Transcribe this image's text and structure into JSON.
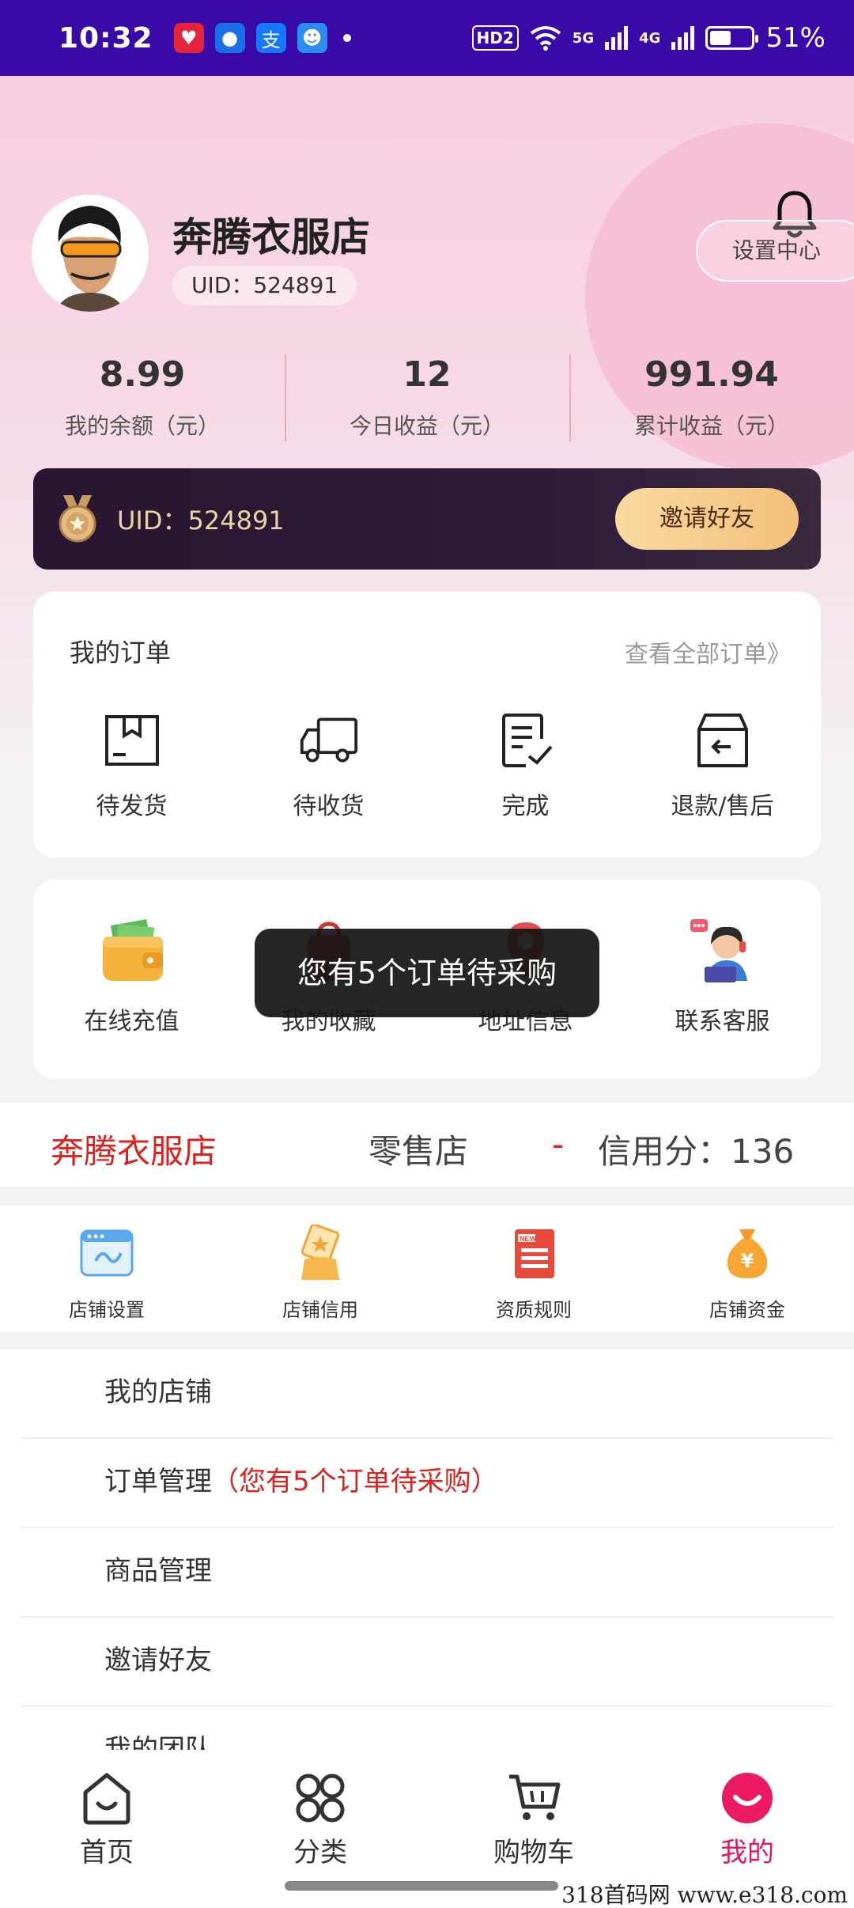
{
  "status_bar": {
    "time": "10:32",
    "hd": "HD2",
    "net1": "5G",
    "net2": "4G",
    "battery": "51%"
  },
  "profile": {
    "shop_name": "奔腾衣服店",
    "uid_pill": "UID：524891",
    "settings": "设置中心"
  },
  "stats": [
    {
      "value": "8.99",
      "label": "我的余额（元）"
    },
    {
      "value": "12",
      "label": "今日收益（元）"
    },
    {
      "value": "991.94",
      "label": "累计收益（元）"
    }
  ],
  "vip": {
    "uid": "UID：524891",
    "invite": "邀请好友"
  },
  "orders": {
    "title": "我的订单",
    "more": "查看全部订单》",
    "items": [
      "待发货",
      "待收货",
      "完成",
      "退款/售后"
    ]
  },
  "tools": {
    "items": [
      "在线充值",
      "我的收藏",
      "地址信息",
      "联系客服"
    ]
  },
  "toast": "您有5个订单待采购",
  "shop_row": {
    "name": "奔腾衣服店",
    "type": "零售店",
    "dash": "-",
    "credit": "信用分：136"
  },
  "shop_tools": [
    "店铺设置",
    "店铺信用",
    "资质规则",
    "店铺资金"
  ],
  "menu": {
    "my_shop": "我的店铺",
    "order_mgmt": "订单管理",
    "order_note": "（您有5个订单待采购）",
    "goods_mgmt": "商品管理",
    "invite": "邀请好友",
    "team": "我的团队"
  },
  "tabbar": [
    "首页",
    "分类",
    "购物车",
    "我的"
  ],
  "watermark": "318首码网  www.e318.com",
  "colors": {
    "status_bar": "#3a0aa8",
    "accent_red": "#e0201c",
    "active_tab": "#e8155e",
    "gold": "#f4c07a"
  },
  "icons": {
    "orders": [
      "box-icon",
      "truck-icon",
      "checklist-icon",
      "return-box-icon"
    ],
    "tools": [
      "wallet-icon",
      "favorites-bag-icon",
      "location-pin-icon",
      "customer-service-icon"
    ],
    "shop_tools": [
      "shop-settings-icon",
      "shop-credit-icon",
      "rules-document-icon",
      "money-bag-icon"
    ],
    "tabbar": [
      "home-icon",
      "category-icon",
      "cart-icon",
      "profile-icon"
    ]
  }
}
